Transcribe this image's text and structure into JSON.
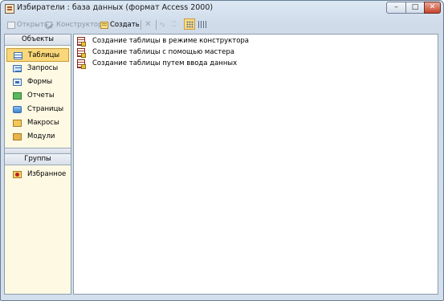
{
  "window": {
    "title": "Избиратели : база данных (формат Access 2000)",
    "controls": {
      "minimize": "–",
      "maximize": "□",
      "close": "✕"
    }
  },
  "toolbar": {
    "open_label": "Открыть",
    "design_label": "Конструктор",
    "create_label": "Создать",
    "delete_glyph": "✕",
    "small_icons_glyph": "ᵃ₂",
    "list_glyph": "⁚⁚"
  },
  "sidebar": {
    "objects_header": "Объекты",
    "items": [
      {
        "label": "Таблицы",
        "icon": "table-icon",
        "selected": true
      },
      {
        "label": "Запросы",
        "icon": "query-icon"
      },
      {
        "label": "Формы",
        "icon": "form-icon"
      },
      {
        "label": "Отчеты",
        "icon": "report-icon"
      },
      {
        "label": "Страницы",
        "icon": "page-icon"
      },
      {
        "label": "Макросы",
        "icon": "macro-icon"
      },
      {
        "label": "Модули",
        "icon": "module-icon"
      }
    ],
    "groups_header": "Группы",
    "groups": [
      {
        "label": "Избранное",
        "icon": "favorites-folder-icon"
      }
    ]
  },
  "main": {
    "shortcuts": [
      {
        "label": "Создание таблицы в режиме конструктора",
        "icon": "create-table-design-icon"
      },
      {
        "label": "Создание таблицы с помощью мастера",
        "icon": "create-table-wizard-icon"
      },
      {
        "label": "Создание таблицы путем ввода данных",
        "icon": "create-table-entry-icon"
      }
    ]
  }
}
